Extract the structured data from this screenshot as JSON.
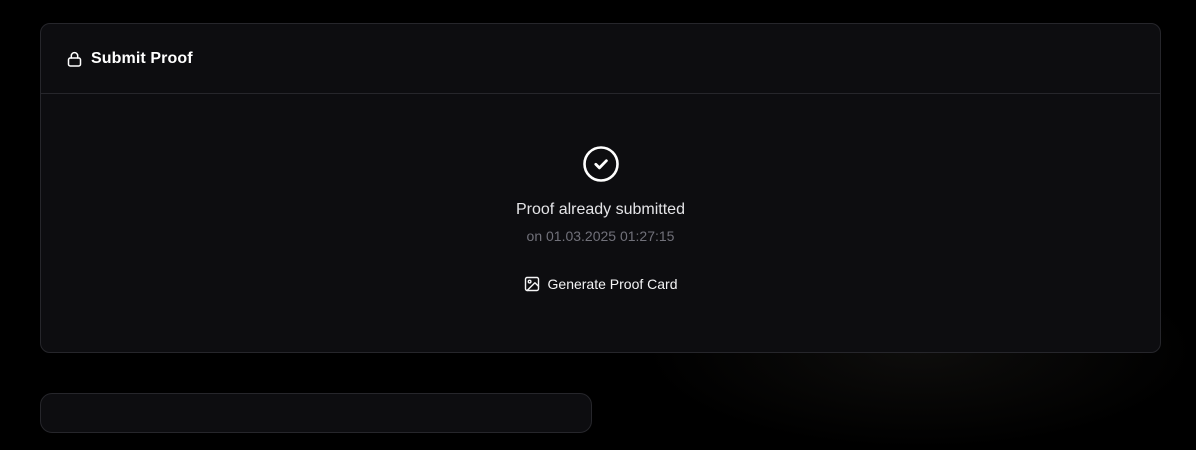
{
  "card": {
    "title": "Submit Proof",
    "header_icon": "lock-icon"
  },
  "status": {
    "icon": "check-circle-icon",
    "message": "Proof already submitted",
    "date": "on 01.03.2025 01:27:15"
  },
  "actions": {
    "generate_label": "Generate Proof Card",
    "generate_icon": "image-icon"
  },
  "colors": {
    "background": "#000000",
    "card": "#0d0d10",
    "border": "#26262b",
    "muted_text": "#71717a"
  }
}
